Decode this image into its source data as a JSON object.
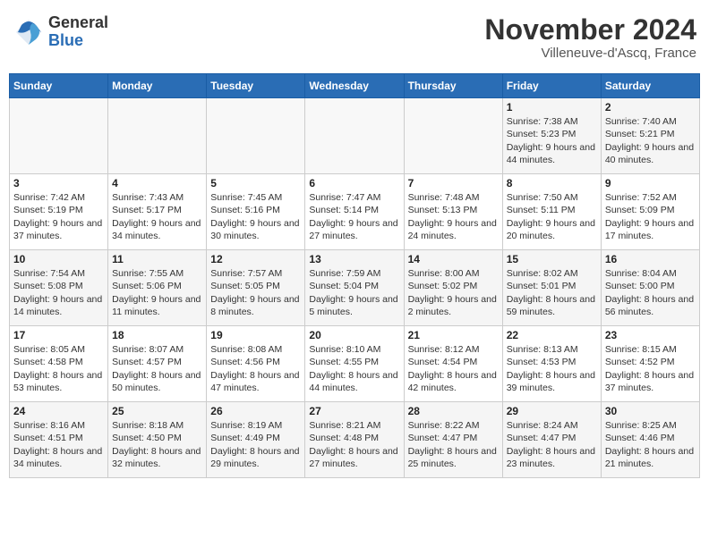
{
  "logo": {
    "general": "General",
    "blue": "Blue"
  },
  "title": {
    "month_year": "November 2024",
    "location": "Villeneuve-d'Ascq, France"
  },
  "days_of_week": [
    "Sunday",
    "Monday",
    "Tuesday",
    "Wednesday",
    "Thursday",
    "Friday",
    "Saturday"
  ],
  "weeks": [
    [
      {
        "day": "",
        "info": ""
      },
      {
        "day": "",
        "info": ""
      },
      {
        "day": "",
        "info": ""
      },
      {
        "day": "",
        "info": ""
      },
      {
        "day": "",
        "info": ""
      },
      {
        "day": "1",
        "info": "Sunrise: 7:38 AM\nSunset: 5:23 PM\nDaylight: 9 hours and 44 minutes."
      },
      {
        "day": "2",
        "info": "Sunrise: 7:40 AM\nSunset: 5:21 PM\nDaylight: 9 hours and 40 minutes."
      }
    ],
    [
      {
        "day": "3",
        "info": "Sunrise: 7:42 AM\nSunset: 5:19 PM\nDaylight: 9 hours and 37 minutes."
      },
      {
        "day": "4",
        "info": "Sunrise: 7:43 AM\nSunset: 5:17 PM\nDaylight: 9 hours and 34 minutes."
      },
      {
        "day": "5",
        "info": "Sunrise: 7:45 AM\nSunset: 5:16 PM\nDaylight: 9 hours and 30 minutes."
      },
      {
        "day": "6",
        "info": "Sunrise: 7:47 AM\nSunset: 5:14 PM\nDaylight: 9 hours and 27 minutes."
      },
      {
        "day": "7",
        "info": "Sunrise: 7:48 AM\nSunset: 5:13 PM\nDaylight: 9 hours and 24 minutes."
      },
      {
        "day": "8",
        "info": "Sunrise: 7:50 AM\nSunset: 5:11 PM\nDaylight: 9 hours and 20 minutes."
      },
      {
        "day": "9",
        "info": "Sunrise: 7:52 AM\nSunset: 5:09 PM\nDaylight: 9 hours and 17 minutes."
      }
    ],
    [
      {
        "day": "10",
        "info": "Sunrise: 7:54 AM\nSunset: 5:08 PM\nDaylight: 9 hours and 14 minutes."
      },
      {
        "day": "11",
        "info": "Sunrise: 7:55 AM\nSunset: 5:06 PM\nDaylight: 9 hours and 11 minutes."
      },
      {
        "day": "12",
        "info": "Sunrise: 7:57 AM\nSunset: 5:05 PM\nDaylight: 9 hours and 8 minutes."
      },
      {
        "day": "13",
        "info": "Sunrise: 7:59 AM\nSunset: 5:04 PM\nDaylight: 9 hours and 5 minutes."
      },
      {
        "day": "14",
        "info": "Sunrise: 8:00 AM\nSunset: 5:02 PM\nDaylight: 9 hours and 2 minutes."
      },
      {
        "day": "15",
        "info": "Sunrise: 8:02 AM\nSunset: 5:01 PM\nDaylight: 8 hours and 59 minutes."
      },
      {
        "day": "16",
        "info": "Sunrise: 8:04 AM\nSunset: 5:00 PM\nDaylight: 8 hours and 56 minutes."
      }
    ],
    [
      {
        "day": "17",
        "info": "Sunrise: 8:05 AM\nSunset: 4:58 PM\nDaylight: 8 hours and 53 minutes."
      },
      {
        "day": "18",
        "info": "Sunrise: 8:07 AM\nSunset: 4:57 PM\nDaylight: 8 hours and 50 minutes."
      },
      {
        "day": "19",
        "info": "Sunrise: 8:08 AM\nSunset: 4:56 PM\nDaylight: 8 hours and 47 minutes."
      },
      {
        "day": "20",
        "info": "Sunrise: 8:10 AM\nSunset: 4:55 PM\nDaylight: 8 hours and 44 minutes."
      },
      {
        "day": "21",
        "info": "Sunrise: 8:12 AM\nSunset: 4:54 PM\nDaylight: 8 hours and 42 minutes."
      },
      {
        "day": "22",
        "info": "Sunrise: 8:13 AM\nSunset: 4:53 PM\nDaylight: 8 hours and 39 minutes."
      },
      {
        "day": "23",
        "info": "Sunrise: 8:15 AM\nSunset: 4:52 PM\nDaylight: 8 hours and 37 minutes."
      }
    ],
    [
      {
        "day": "24",
        "info": "Sunrise: 8:16 AM\nSunset: 4:51 PM\nDaylight: 8 hours and 34 minutes."
      },
      {
        "day": "25",
        "info": "Sunrise: 8:18 AM\nSunset: 4:50 PM\nDaylight: 8 hours and 32 minutes."
      },
      {
        "day": "26",
        "info": "Sunrise: 8:19 AM\nSunset: 4:49 PM\nDaylight: 8 hours and 29 minutes."
      },
      {
        "day": "27",
        "info": "Sunrise: 8:21 AM\nSunset: 4:48 PM\nDaylight: 8 hours and 27 minutes."
      },
      {
        "day": "28",
        "info": "Sunrise: 8:22 AM\nSunset: 4:47 PM\nDaylight: 8 hours and 25 minutes."
      },
      {
        "day": "29",
        "info": "Sunrise: 8:24 AM\nSunset: 4:47 PM\nDaylight: 8 hours and 23 minutes."
      },
      {
        "day": "30",
        "info": "Sunrise: 8:25 AM\nSunset: 4:46 PM\nDaylight: 8 hours and 21 minutes."
      }
    ]
  ]
}
